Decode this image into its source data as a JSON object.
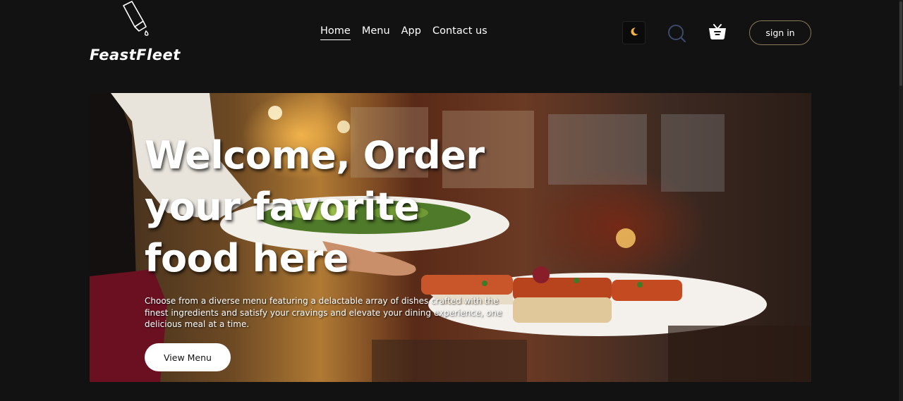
{
  "brand": {
    "name": "FeastFleet",
    "icon": "salt-shaker-icon"
  },
  "nav": {
    "items": [
      {
        "label": "Home",
        "active": true
      },
      {
        "label": "Menu",
        "active": false
      },
      {
        "label": "App",
        "active": false
      },
      {
        "label": "Contact us",
        "active": false
      }
    ]
  },
  "header_actions": {
    "theme_icon": "moon-icon",
    "search_icon": "search-icon",
    "cart_icon": "basket-icon",
    "signin_label": "sign in"
  },
  "hero": {
    "title": "Welcome, Order your favorite food here",
    "description": "Choose from a diverse menu featuring a delactable array of dishes crafted with the finest ingredients and satisfy your cravings and elevate your dining experience, one delicious meal at a time.",
    "button_label": "View Menu"
  },
  "colors": {
    "background": "#121212",
    "accent_moon": "#f5b342",
    "search_ring": "#3b4a6b",
    "signin_border": "#8a7a55"
  }
}
